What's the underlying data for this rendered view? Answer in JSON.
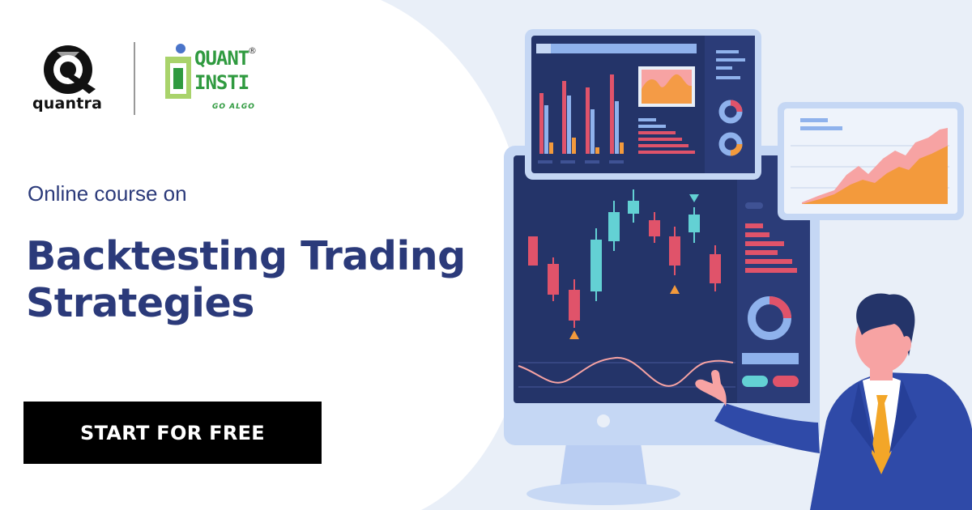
{
  "logos": {
    "quantra": "quantra",
    "quantinsti_line1": "QUANT",
    "quantinsti_line2": "INSTI",
    "quantinsti_tagline": "GO ALGO",
    "registered_mark": "®"
  },
  "hero": {
    "subtitle": "Online course on",
    "title_line1": "Backtesting Trading",
    "title_line2": "Strategies"
  },
  "cta": {
    "label": "START FOR FREE"
  },
  "colors": {
    "navy_text": "#2b3a7a",
    "monitor_dark": "#243469",
    "monitor_bezel": "#b9cdf2",
    "teal": "#63d1d4",
    "red": "#e0536a",
    "orange": "#f39a3c",
    "pink": "#f7a3a3",
    "light_blue": "#8fb2ec",
    "suit": "#2f4aa8",
    "brand_green": "#2f9a3f"
  },
  "icons": {
    "quantra_logo": "quantra-logo-icon",
    "quantinsti_logo": "quantinsti-logo-icon",
    "presenter": "presenter-illustration",
    "monitor": "monitor-illustration"
  }
}
